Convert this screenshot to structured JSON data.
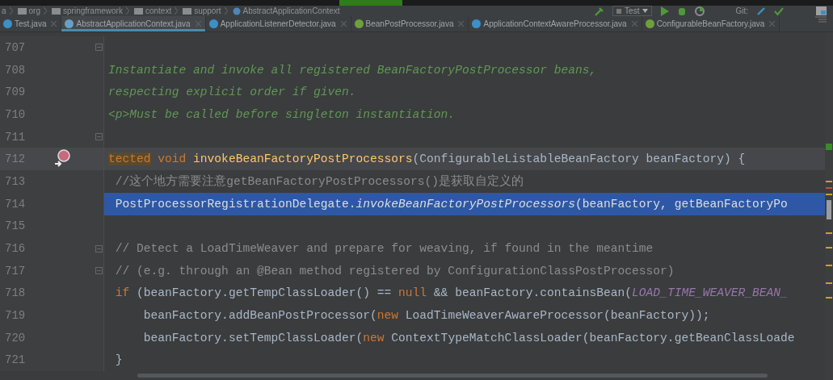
{
  "breadcrumbs": [
    {
      "label": "a",
      "kind": "none"
    },
    {
      "label": "org",
      "kind": "package"
    },
    {
      "label": "springframework",
      "kind": "package"
    },
    {
      "label": "context",
      "kind": "package"
    },
    {
      "label": "support",
      "kind": "package"
    },
    {
      "label": "AbstractApplicationContext",
      "kind": "class"
    }
  ],
  "toolbar": {
    "run_config": "Test",
    "vcs_label": "Git:"
  },
  "tabs": [
    {
      "label": "Test.java",
      "kind": "class",
      "selected": false
    },
    {
      "label": "AbstractApplicationContext.java",
      "kind": "abstract",
      "selected": true
    },
    {
      "label": "ApplicationListenerDetector.java",
      "kind": "class",
      "selected": false
    },
    {
      "label": "BeanPostProcessor.java",
      "kind": "interface",
      "selected": false
    },
    {
      "label": "ApplicationContextAwareProcessor.java",
      "kind": "class",
      "selected": false
    },
    {
      "label": "ConfigurableBeanFactory.java",
      "kind": "interface",
      "selected": false
    }
  ],
  "lines": [
    {
      "number": "707",
      "current": false,
      "selected": false,
      "fold": true,
      "marker": false
    },
    {
      "number": "708",
      "current": false,
      "selected": false,
      "fold": false,
      "marker": false,
      "segments": [
        {
          "text": "Instantiate and invoke all registered BeanFactoryPostProcessor beans,",
          "kind": "doc"
        }
      ]
    },
    {
      "number": "709",
      "current": false,
      "selected": false,
      "fold": false,
      "marker": false,
      "segments": [
        {
          "text": "respecting explicit order if given.",
          "kind": "doc"
        }
      ]
    },
    {
      "number": "710",
      "current": false,
      "selected": false,
      "fold": false,
      "marker": false,
      "segments": [
        {
          "text": "<p>Must be called before singleton instantiation.",
          "kind": "doc"
        }
      ]
    },
    {
      "number": "711",
      "current": false,
      "selected": false,
      "fold": true,
      "marker": false
    },
    {
      "number": "712",
      "current": true,
      "selected": false,
      "fold": false,
      "marker": true,
      "segments": [
        {
          "text": "tected",
          "kind": "keyword-match"
        },
        {
          "text": " void ",
          "kind": "keyword"
        },
        {
          "text": "invokeBeanFactoryPostProcessors",
          "kind": "method"
        },
        {
          "text": "(ConfigurableListableBeanFactory beanFactory) {",
          "kind": "plain"
        }
      ]
    },
    {
      "number": "713",
      "current": false,
      "selected": false,
      "fold": false,
      "marker": false,
      "segments": [
        {
          "text": " //这个地方需要注意getBeanFactoryPostProcessors()是获取自定义的",
          "kind": "comment"
        }
      ]
    },
    {
      "number": "714",
      "current": false,
      "selected": true,
      "fold": false,
      "marker": false,
      "segments": [
        {
          "text": " PostProcessorRegistrationDelegate.",
          "kind": "plain"
        },
        {
          "text": "invokeBeanFactoryPostProcessors",
          "kind": "static"
        },
        {
          "text": "(beanFactory, getBeanFactoryPo",
          "kind": "plain"
        }
      ]
    },
    {
      "number": "715",
      "current": false,
      "selected": false,
      "fold": false,
      "marker": false
    },
    {
      "number": "716",
      "current": false,
      "selected": false,
      "fold": true,
      "marker": false,
      "segments": [
        {
          "text": " // Detect a LoadTimeWeaver and prepare for weaving, if found in the meantime",
          "kind": "comment"
        }
      ]
    },
    {
      "number": "717",
      "current": false,
      "selected": false,
      "fold": true,
      "marker": false,
      "segments": [
        {
          "text": " // (e.g. through an @Bean method registered by ConfigurationClassPostProcessor)",
          "kind": "comment"
        }
      ]
    },
    {
      "number": "718",
      "current": false,
      "selected": false,
      "fold": false,
      "marker": false,
      "segments": [
        {
          "text": " if",
          "kind": "keyword"
        },
        {
          "text": " (beanFactory.getTempClassLoader() == ",
          "kind": "plain"
        },
        {
          "text": "null",
          "kind": "keyword"
        },
        {
          "text": " && beanFactory.containsBean(",
          "kind": "plain"
        },
        {
          "text": "LOAD_TIME_WEAVER_BEAN_",
          "kind": "constant"
        }
      ]
    },
    {
      "number": "719",
      "current": false,
      "selected": false,
      "fold": false,
      "marker": false,
      "segments": [
        {
          "text": "     beanFactory.addBeanPostProcessor(",
          "kind": "plain"
        },
        {
          "text": "new",
          "kind": "keyword"
        },
        {
          "text": " LoadTimeWeaverAwareProcessor(beanFactory));",
          "kind": "plain"
        }
      ]
    },
    {
      "number": "720",
      "current": false,
      "selected": false,
      "fold": false,
      "marker": false,
      "segments": [
        {
          "text": "     beanFactory.setTempClassLoader(",
          "kind": "plain"
        },
        {
          "text": "new",
          "kind": "keyword"
        },
        {
          "text": " ContextTypeMatchClassLoader(beanFactory.getBeanClassLoade",
          "kind": "plain"
        }
      ]
    },
    {
      "number": "721",
      "current": false,
      "selected": false,
      "fold": false,
      "marker": false,
      "segments": [
        {
          "text": " }",
          "kind": "plain"
        }
      ]
    }
  ]
}
